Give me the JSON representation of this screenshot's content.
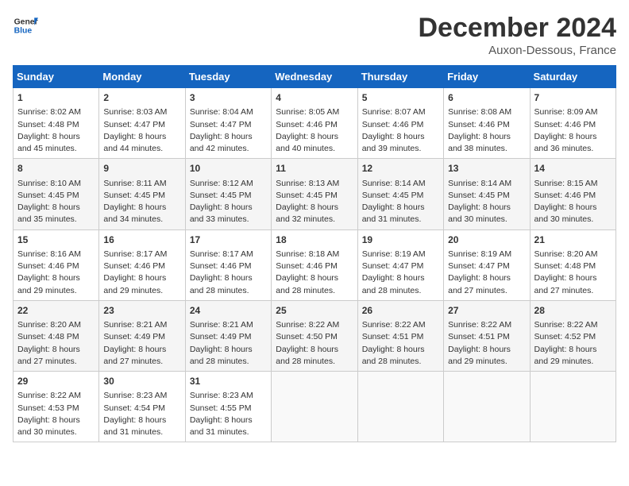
{
  "header": {
    "logo_general": "General",
    "logo_blue": "Blue",
    "title": "December 2024",
    "subtitle": "Auxon-Dessous, France"
  },
  "days_of_week": [
    "Sunday",
    "Monday",
    "Tuesday",
    "Wednesday",
    "Thursday",
    "Friday",
    "Saturday"
  ],
  "weeks": [
    [
      {
        "day": "1",
        "sunrise": "Sunrise: 8:02 AM",
        "sunset": "Sunset: 4:48 PM",
        "daylight": "Daylight: 8 hours and 45 minutes."
      },
      {
        "day": "2",
        "sunrise": "Sunrise: 8:03 AM",
        "sunset": "Sunset: 4:47 PM",
        "daylight": "Daylight: 8 hours and 44 minutes."
      },
      {
        "day": "3",
        "sunrise": "Sunrise: 8:04 AM",
        "sunset": "Sunset: 4:47 PM",
        "daylight": "Daylight: 8 hours and 42 minutes."
      },
      {
        "day": "4",
        "sunrise": "Sunrise: 8:05 AM",
        "sunset": "Sunset: 4:46 PM",
        "daylight": "Daylight: 8 hours and 40 minutes."
      },
      {
        "day": "5",
        "sunrise": "Sunrise: 8:07 AM",
        "sunset": "Sunset: 4:46 PM",
        "daylight": "Daylight: 8 hours and 39 minutes."
      },
      {
        "day": "6",
        "sunrise": "Sunrise: 8:08 AM",
        "sunset": "Sunset: 4:46 PM",
        "daylight": "Daylight: 8 hours and 38 minutes."
      },
      {
        "day": "7",
        "sunrise": "Sunrise: 8:09 AM",
        "sunset": "Sunset: 4:46 PM",
        "daylight": "Daylight: 8 hours and 36 minutes."
      }
    ],
    [
      {
        "day": "8",
        "sunrise": "Sunrise: 8:10 AM",
        "sunset": "Sunset: 4:45 PM",
        "daylight": "Daylight: 8 hours and 35 minutes."
      },
      {
        "day": "9",
        "sunrise": "Sunrise: 8:11 AM",
        "sunset": "Sunset: 4:45 PM",
        "daylight": "Daylight: 8 hours and 34 minutes."
      },
      {
        "day": "10",
        "sunrise": "Sunrise: 8:12 AM",
        "sunset": "Sunset: 4:45 PM",
        "daylight": "Daylight: 8 hours and 33 minutes."
      },
      {
        "day": "11",
        "sunrise": "Sunrise: 8:13 AM",
        "sunset": "Sunset: 4:45 PM",
        "daylight": "Daylight: 8 hours and 32 minutes."
      },
      {
        "day": "12",
        "sunrise": "Sunrise: 8:14 AM",
        "sunset": "Sunset: 4:45 PM",
        "daylight": "Daylight: 8 hours and 31 minutes."
      },
      {
        "day": "13",
        "sunrise": "Sunrise: 8:14 AM",
        "sunset": "Sunset: 4:45 PM",
        "daylight": "Daylight: 8 hours and 30 minutes."
      },
      {
        "day": "14",
        "sunrise": "Sunrise: 8:15 AM",
        "sunset": "Sunset: 4:46 PM",
        "daylight": "Daylight: 8 hours and 30 minutes."
      }
    ],
    [
      {
        "day": "15",
        "sunrise": "Sunrise: 8:16 AM",
        "sunset": "Sunset: 4:46 PM",
        "daylight": "Daylight: 8 hours and 29 minutes."
      },
      {
        "day": "16",
        "sunrise": "Sunrise: 8:17 AM",
        "sunset": "Sunset: 4:46 PM",
        "daylight": "Daylight: 8 hours and 29 minutes."
      },
      {
        "day": "17",
        "sunrise": "Sunrise: 8:17 AM",
        "sunset": "Sunset: 4:46 PM",
        "daylight": "Daylight: 8 hours and 28 minutes."
      },
      {
        "day": "18",
        "sunrise": "Sunrise: 8:18 AM",
        "sunset": "Sunset: 4:46 PM",
        "daylight": "Daylight: 8 hours and 28 minutes."
      },
      {
        "day": "19",
        "sunrise": "Sunrise: 8:19 AM",
        "sunset": "Sunset: 4:47 PM",
        "daylight": "Daylight: 8 hours and 28 minutes."
      },
      {
        "day": "20",
        "sunrise": "Sunrise: 8:19 AM",
        "sunset": "Sunset: 4:47 PM",
        "daylight": "Daylight: 8 hours and 27 minutes."
      },
      {
        "day": "21",
        "sunrise": "Sunrise: 8:20 AM",
        "sunset": "Sunset: 4:48 PM",
        "daylight": "Daylight: 8 hours and 27 minutes."
      }
    ],
    [
      {
        "day": "22",
        "sunrise": "Sunrise: 8:20 AM",
        "sunset": "Sunset: 4:48 PM",
        "daylight": "Daylight: 8 hours and 27 minutes."
      },
      {
        "day": "23",
        "sunrise": "Sunrise: 8:21 AM",
        "sunset": "Sunset: 4:49 PM",
        "daylight": "Daylight: 8 hours and 27 minutes."
      },
      {
        "day": "24",
        "sunrise": "Sunrise: 8:21 AM",
        "sunset": "Sunset: 4:49 PM",
        "daylight": "Daylight: 8 hours and 28 minutes."
      },
      {
        "day": "25",
        "sunrise": "Sunrise: 8:22 AM",
        "sunset": "Sunset: 4:50 PM",
        "daylight": "Daylight: 8 hours and 28 minutes."
      },
      {
        "day": "26",
        "sunrise": "Sunrise: 8:22 AM",
        "sunset": "Sunset: 4:51 PM",
        "daylight": "Daylight: 8 hours and 28 minutes."
      },
      {
        "day": "27",
        "sunrise": "Sunrise: 8:22 AM",
        "sunset": "Sunset: 4:51 PM",
        "daylight": "Daylight: 8 hours and 29 minutes."
      },
      {
        "day": "28",
        "sunrise": "Sunrise: 8:22 AM",
        "sunset": "Sunset: 4:52 PM",
        "daylight": "Daylight: 8 hours and 29 minutes."
      }
    ],
    [
      {
        "day": "29",
        "sunrise": "Sunrise: 8:22 AM",
        "sunset": "Sunset: 4:53 PM",
        "daylight": "Daylight: 8 hours and 30 minutes."
      },
      {
        "day": "30",
        "sunrise": "Sunrise: 8:23 AM",
        "sunset": "Sunset: 4:54 PM",
        "daylight": "Daylight: 8 hours and 31 minutes."
      },
      {
        "day": "31",
        "sunrise": "Sunrise: 8:23 AM",
        "sunset": "Sunset: 4:55 PM",
        "daylight": "Daylight: 8 hours and 31 minutes."
      },
      null,
      null,
      null,
      null
    ]
  ]
}
